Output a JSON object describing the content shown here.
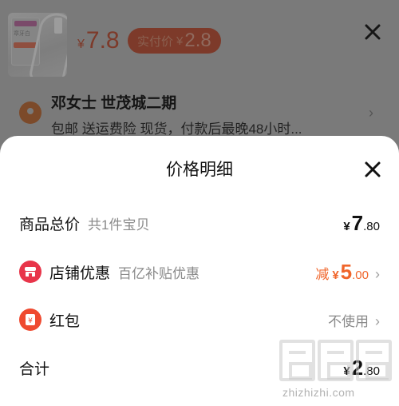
{
  "background": {
    "product_image_text": "章牙白",
    "price": {
      "currency": "¥",
      "value": "7.8"
    },
    "actual_price": {
      "label": "实付价",
      "currency": "¥",
      "value": "2.8"
    },
    "address": "邓女士 世茂城二期",
    "shipping_info": "包邮  送运费险  现货，付款后最晚48小时..."
  },
  "modal": {
    "title": "价格明细",
    "rows": [
      {
        "label": "商品总价",
        "sub": "共1件宝贝",
        "currency": "¥",
        "int": "7",
        "dec": ".80"
      },
      {
        "label": "店铺优惠",
        "sub": "百亿补贴优惠",
        "prefix": "减",
        "currency": "¥",
        "int": "5",
        "dec": ".00",
        "icon": "store-icon"
      },
      {
        "label": "红包",
        "value_text": "不使用",
        "icon": "red-packet-icon"
      },
      {
        "label": "合计",
        "currency": "¥",
        "int": "2",
        "dec": ".80"
      }
    ]
  },
  "watermark": {
    "text": "zhizhizhi.com"
  },
  "colors": {
    "accent": "#f0652a",
    "store_icon": "#e8354a",
    "red_packet_icon": "#ef4a30"
  }
}
